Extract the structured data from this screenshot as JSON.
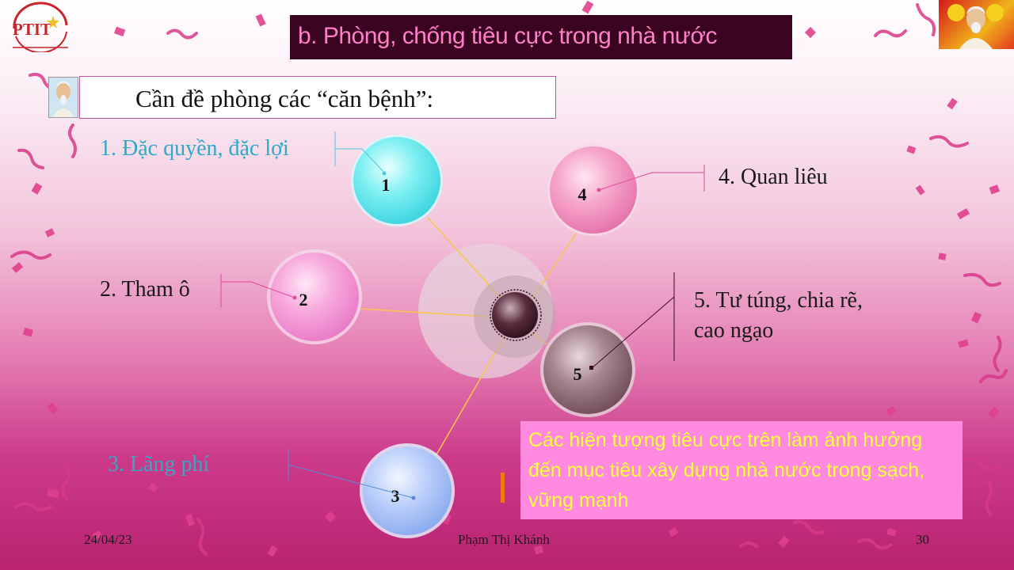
{
  "header": {
    "logo_text": "PTIT",
    "title": "b. Phòng, chống tiêu cực trong nhà nước"
  },
  "subtitle": "Cần đề phòng các “căn bệnh”:",
  "items": [
    {
      "number": "1",
      "label": "1. Đặc quyền, đặc lợi",
      "color": "#2fa9c8"
    },
    {
      "number": "2",
      "label": "2. Tham ô",
      "color": "#1a1a1a"
    },
    {
      "number": "3",
      "label": "3. Lãng phí",
      "color": "#3aa6c2"
    },
    {
      "number": "4",
      "label": "4. Quan liêu",
      "color": "#1a1a1a"
    },
    {
      "number": "5",
      "label_line1": "5. Tư túng, chia rẽ,",
      "label_line2": "cao ngạo",
      "color": "#1a1a1a"
    }
  ],
  "note": "Các hiện tượng tiêu cực trên làm ảnh hưởng đến mục tiêu xây dựng nhà nước trong sạch, vững mạnh",
  "footer": {
    "date": "24/04/23",
    "author": "Phạm Thị Khánh",
    "page": "30"
  },
  "colors": {
    "title_bg": "#3a0320",
    "title_text": "#ff7fc8",
    "note_bg": "#ff8ae0",
    "note_text": "#ffff3a"
  }
}
